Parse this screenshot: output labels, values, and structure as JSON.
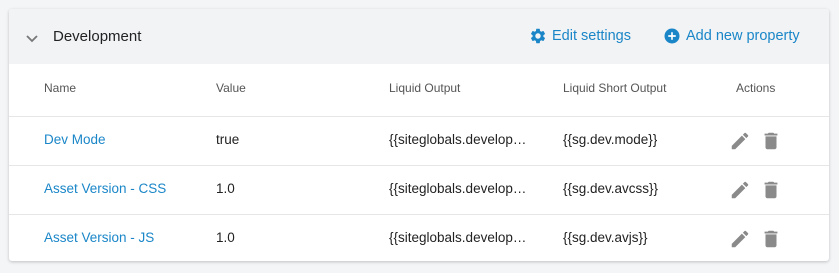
{
  "section": {
    "title": "Development",
    "edit_settings_label": "Edit settings",
    "add_property_label": "Add new property"
  },
  "columns": {
    "name": "Name",
    "value": "Value",
    "liquid_output": "Liquid Output",
    "liquid_short_output": "Liquid Short Output",
    "actions": "Actions"
  },
  "rows": [
    {
      "name": "Dev Mode",
      "value": "true",
      "liquid_output": "{{siteglobals.develop…",
      "liquid_short_output": "{{sg.dev.mode}}"
    },
    {
      "name": "Asset Version - CSS",
      "value": "1.0",
      "liquid_output": "{{siteglobals.develop…",
      "liquid_short_output": "{{sg.dev.avcss}}"
    },
    {
      "name": "Asset Version - JS",
      "value": "1.0",
      "liquid_output": "{{siteglobals.develop…",
      "liquid_short_output": "{{sg.dev.avjs}}"
    }
  ],
  "colors": {
    "accent": "#1a86c8",
    "header_bg": "#f2f3f5",
    "icon_gray": "#8a8a8a"
  },
  "icons": {
    "collapse": "chevron-down-icon",
    "settings": "gear-icon",
    "add": "plus-circle-icon",
    "edit": "pencil-icon",
    "delete": "trash-icon"
  }
}
